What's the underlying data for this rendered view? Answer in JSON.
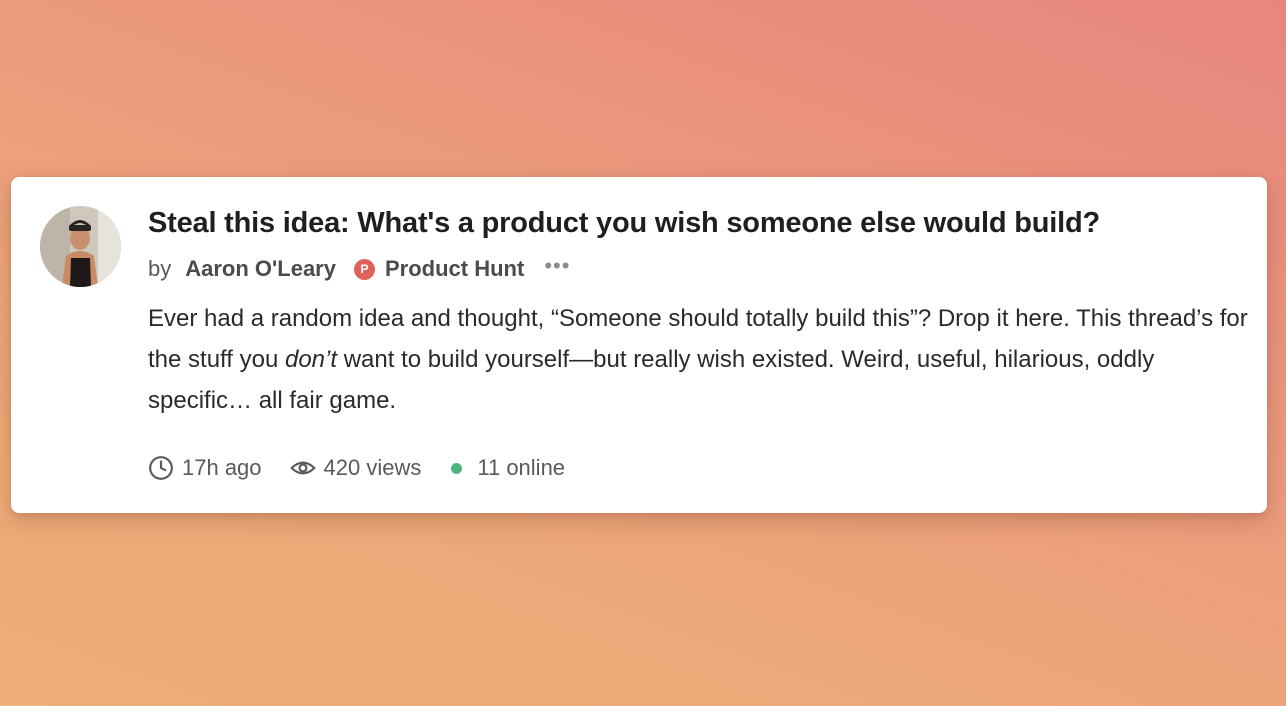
{
  "post": {
    "title": "Steal this idea: What's a product you wish someone else would build?",
    "by_label": "by",
    "author": "Aaron O'Leary",
    "community_badge": "P",
    "community": "Product Hunt",
    "more_label": "•••",
    "body_part1": "Ever had a random idea and thought, “Someone should totally build this”? Drop it here. This thread’s for the stuff you ",
    "body_emphasis": "don’t",
    "body_part2": " want to build yourself—but really wish existed. Weird, useful, hilarious, oddly specific… all fair game."
  },
  "meta": {
    "time": "17h ago",
    "views": "420 views",
    "online": "11 online"
  },
  "icons": {
    "time": "clock-icon",
    "views": "eye-icon",
    "online": "online-dot-icon"
  },
  "colors": {
    "online_dot": "#4cb67a",
    "product_hunt": "#e0635a"
  }
}
